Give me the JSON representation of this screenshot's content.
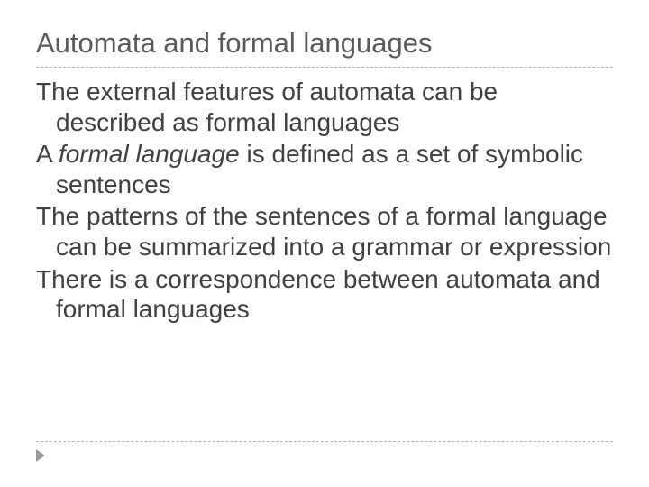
{
  "slide": {
    "title": "Automata and formal languages",
    "p1a": "The external features of automata can be described as formal languages",
    "p2_prefix": "A ",
    "p2_italic": "formal language",
    "p2_suffix": " is defined as a set of symbolic sentences",
    "p3": "The patterns of the sentences of a formal language can be summarized into a grammar or expression",
    "p4": "There is a correspondence between automata and formal languages"
  }
}
